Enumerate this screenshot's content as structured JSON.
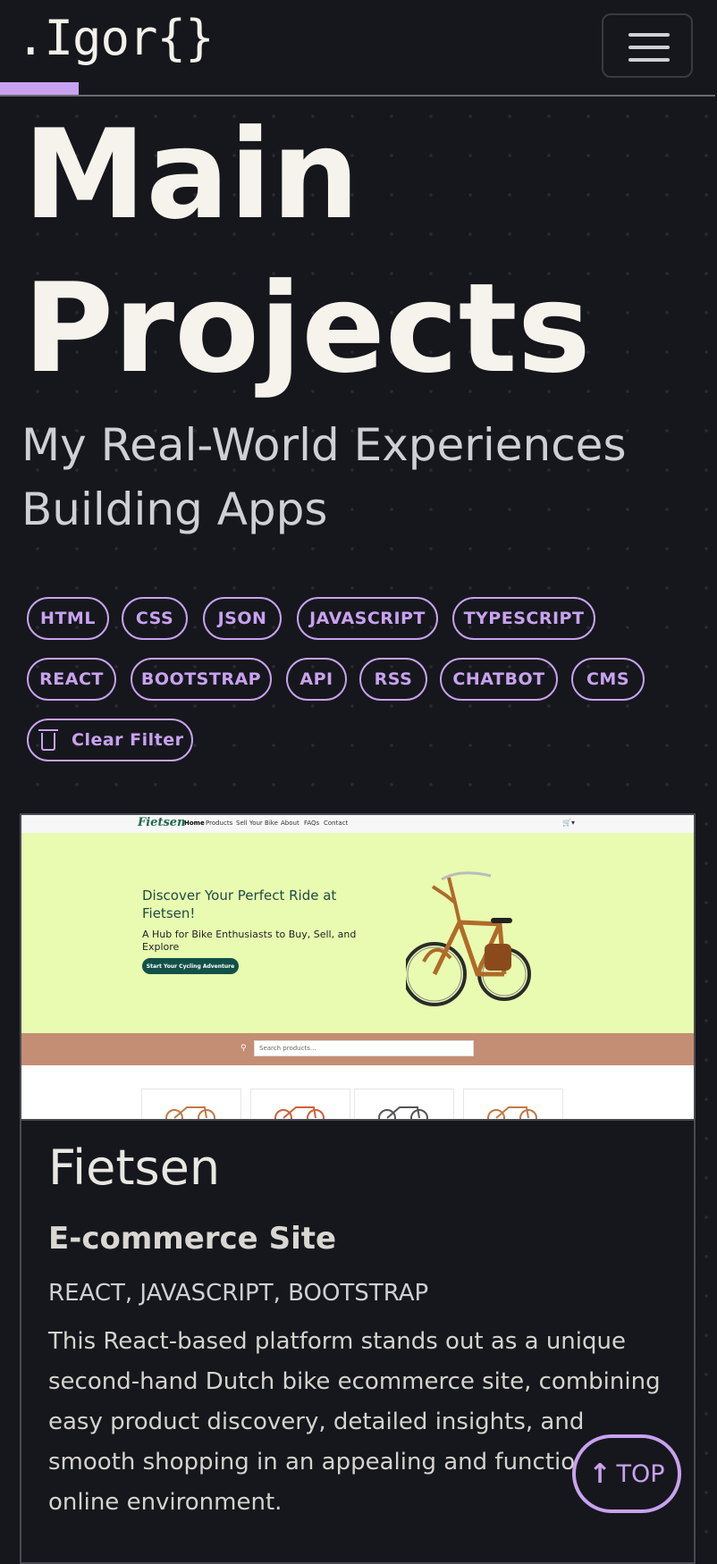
{
  "header": {
    "logo": ".Igor{}",
    "menu_icon": "hamburger-icon"
  },
  "hero": {
    "title_line1": "Main",
    "title_line2": "Projects",
    "subtitle": "My Real-World Experiences Building Apps"
  },
  "filters": {
    "tags": [
      "HTML",
      "CSS",
      "JSON",
      "JAVASCRIPT",
      "TYPESCRIPT",
      "REACT",
      "BOOTSTRAP",
      "API",
      "RSS",
      "CHATBOT",
      "CMS"
    ],
    "clear_label": "Clear Filter",
    "clear_icon": "trash-icon",
    "accent_color": "#c8a2f0"
  },
  "project": {
    "title": "Fietsen",
    "subtitle": "E-commerce Site",
    "tags": "REACT, JAVASCRIPT, BOOTSTRAP",
    "description": "This React-based platform stands out as a unique second-hand Dutch bike ecommerce site, combining easy product discovery, detailed insights, and smooth shopping in an appealing and functional online environment.",
    "screenshot": {
      "brand": "Fietsen",
      "nav": [
        "Home",
        "Products",
        "Sell Your Bike",
        "About",
        "FAQs",
        "Contact"
      ],
      "cart_icon": "cart-icon",
      "heading": "Discover Your Perfect Ride at Fietsen!",
      "tagline": "A Hub for Bike Enthusiasts to Buy, Sell, and Explore",
      "cta": "Start Your Cycling Adventure",
      "search_placeholder": "Search products..."
    }
  },
  "top_button": {
    "label": "TOP",
    "icon": "arrow-up-icon"
  }
}
